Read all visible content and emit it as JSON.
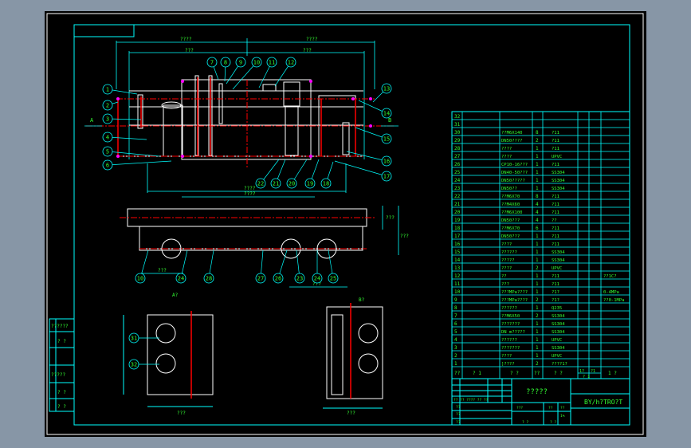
{
  "colors": {
    "background": "#000000",
    "frame": "#00ffff",
    "outline": "#ffffff",
    "centerline": "#ff0000",
    "text": "#33ff33",
    "joint": "#ff00ff",
    "viewport_border": "#8796a6"
  },
  "front_view": {
    "balloons": [
      "1",
      "2",
      "3",
      "4",
      "5",
      "6",
      "7",
      "8",
      "9",
      "10",
      "11",
      "12",
      "13",
      "14",
      "15",
      "16",
      "17",
      "18",
      "19",
      "20",
      "21",
      "22"
    ],
    "dimensions": {
      "overall_left": "????",
      "overall_right": "????",
      "inner_left": "???",
      "inner_right": "???",
      "bottom": "????"
    },
    "inlet_label": "A",
    "outlet_label": "B"
  },
  "top_view": {
    "balloons": [
      "10",
      "24",
      "28",
      "27",
      "26",
      "23",
      "24",
      "25"
    ],
    "dimensions": {
      "top": "????",
      "right_1": "???",
      "right_2": "???",
      "bottom_1": "???",
      "bottom_2": "???"
    }
  },
  "side_view_a": {
    "title": "A?",
    "balloons": [
      "31",
      "32"
    ],
    "dimension": "???"
  },
  "side_view_b": {
    "title": "B?",
    "dimension": "???"
  },
  "left_strip": {
    "items": [
      "??????",
      "? ?",
      "?????",
      "? ?",
      "? ?"
    ]
  },
  "parts_list": {
    "rows": [
      {
        "no": "32",
        "name": "",
        "qty": "",
        "material": "",
        "note": ""
      },
      {
        "no": "31",
        "name": "",
        "qty": "",
        "material": "",
        "note": ""
      },
      {
        "no": "30",
        "name": "??M6X140",
        "qty": "8",
        "material": "?11",
        "note": ""
      },
      {
        "no": "29",
        "name": "DN50????",
        "qty": "2",
        "material": "?11",
        "note": ""
      },
      {
        "no": "28",
        "name": "????",
        "qty": "1",
        "material": "?11",
        "note": ""
      },
      {
        "no": "27",
        "name": "????",
        "qty": "1",
        "material": "UPVC",
        "note": ""
      },
      {
        "no": "26",
        "name": "CP10-16???",
        "qty": "1",
        "material": "?11",
        "note": ""
      },
      {
        "no": "25",
        "name": "DN40-50???",
        "qty": "1",
        "material": "SS304",
        "note": ""
      },
      {
        "no": "24",
        "name": "DN50?????",
        "qty": "1",
        "material": "SS304",
        "note": ""
      },
      {
        "no": "23",
        "name": "DN50??",
        "qty": "1",
        "material": "SS304",
        "note": ""
      },
      {
        "no": "22",
        "name": "??M6X70",
        "qty": "8",
        "material": "?11",
        "note": ""
      },
      {
        "no": "21",
        "name": "??M4X60",
        "qty": "4",
        "material": "?11",
        "note": ""
      },
      {
        "no": "20",
        "name": "??M6X100",
        "qty": "4",
        "material": "?11",
        "note": ""
      },
      {
        "no": "19",
        "name": "DN50???",
        "qty": "4",
        "material": "??",
        "note": ""
      },
      {
        "no": "18",
        "name": "??M6X70",
        "qty": "6",
        "material": "?11",
        "note": ""
      },
      {
        "no": "17",
        "name": "DN50???",
        "qty": "1",
        "material": "?11",
        "note": ""
      },
      {
        "no": "16",
        "name": "????",
        "qty": "1",
        "material": "?11",
        "note": ""
      },
      {
        "no": "15",
        "name": "??????",
        "qty": "1",
        "material": "SS304",
        "note": ""
      },
      {
        "no": "14",
        "name": "?????",
        "qty": "1",
        "material": "SS304",
        "note": ""
      },
      {
        "no": "13",
        "name": "????",
        "qty": "2",
        "material": "UPVC",
        "note": ""
      },
      {
        "no": "12",
        "name": "??",
        "qty": "1",
        "material": "?11",
        "note": "??1C?"
      },
      {
        "no": "11",
        "name": "???",
        "qty": "1",
        "material": "?11",
        "note": ""
      },
      {
        "no": "10",
        "name": "???MPa????",
        "qty": "1",
        "material": "?1?",
        "note": "0-4MPa"
      },
      {
        "no": "9",
        "name": "???MPa????",
        "qty": "2",
        "material": "?1?",
        "note": "??0-1MPa"
      },
      {
        "no": "8",
        "name": "??????",
        "qty": "1",
        "material": "Q235",
        "note": ""
      },
      {
        "no": "7",
        "name": "??M6X50",
        "qty": "2",
        "material": "SS304",
        "note": ""
      },
      {
        "no": "6",
        "name": "???????",
        "qty": "1",
        "material": "SS304",
        "note": ""
      },
      {
        "no": "5",
        "name": "DN m?????",
        "qty": "1",
        "material": "SS304",
        "note": ""
      },
      {
        "no": "4",
        "name": "??????",
        "qty": "1",
        "material": "UPVC",
        "note": ""
      },
      {
        "no": "3",
        "name": "???????",
        "qty": "1",
        "material": "SS304",
        "note": ""
      },
      {
        "no": "2",
        "name": "????",
        "qty": "1",
        "material": "UPVC",
        "note": ""
      },
      {
        "no": "1",
        "name": "]????",
        "qty": "2",
        "material": "????1?",
        "note": ""
      }
    ],
    "header": {
      "no": "??",
      "code": "? 1",
      "name": "? ?",
      "qty": "??",
      "material": "? ?",
      "weight_single": "1?",
      "weight_total": "?1",
      "weight": "? 1",
      "note": "1 ?"
    }
  },
  "title_block": {
    "drawing_title": "?????",
    "drawing_number": "BY/h?TRO?T",
    "labels": [
      "?? ?? ???? ?? ??",
      "??",
      "??",
      "??",
      "???",
      "??",
      "??",
      "? ?",
      "? ?",
      "1%"
    ]
  }
}
